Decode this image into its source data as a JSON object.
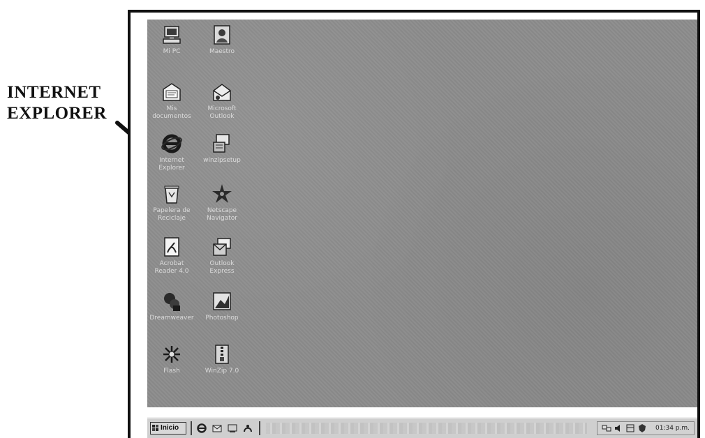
{
  "callout": {
    "line1": "INTERNET",
    "line2": "EXPLORER"
  },
  "desktop": {
    "background_color": "#8c8c8c",
    "icons": [
      {
        "label": "Mi PC",
        "icon": "my-computer-icon"
      },
      {
        "label": "Mis\ndocumentos",
        "icon": "my-documents-icon"
      },
      {
        "label": "Internet\nExplorer",
        "icon": "internet-explorer-icon"
      },
      {
        "label": "Papelera de\nReciclaje",
        "icon": "recycle-bin-icon"
      },
      {
        "label": "Acrobat\nReader 4.0",
        "icon": "acrobat-reader-icon"
      },
      {
        "label": "Dreamweaver",
        "icon": "dreamweaver-icon"
      },
      {
        "label": "Flash",
        "icon": "flash-icon"
      },
      {
        "label": "Maestro",
        "icon": "portrait-icon"
      },
      {
        "label": "Microsoft\nOutlook",
        "icon": "outlook-icon"
      },
      {
        "label": "winzipsetup",
        "icon": "setup-icon"
      },
      {
        "label": "Netscape\nNavigator",
        "icon": "netscape-icon"
      },
      {
        "label": "Outlook\nExpress",
        "icon": "outlook-express-icon"
      },
      {
        "label": "Photoshop",
        "icon": "photoshop-icon"
      },
      {
        "label": "WinZip 7.0",
        "icon": "winzip-icon"
      }
    ]
  },
  "taskbar": {
    "start_label": "Inicio",
    "clock": "01:34 p.m."
  }
}
